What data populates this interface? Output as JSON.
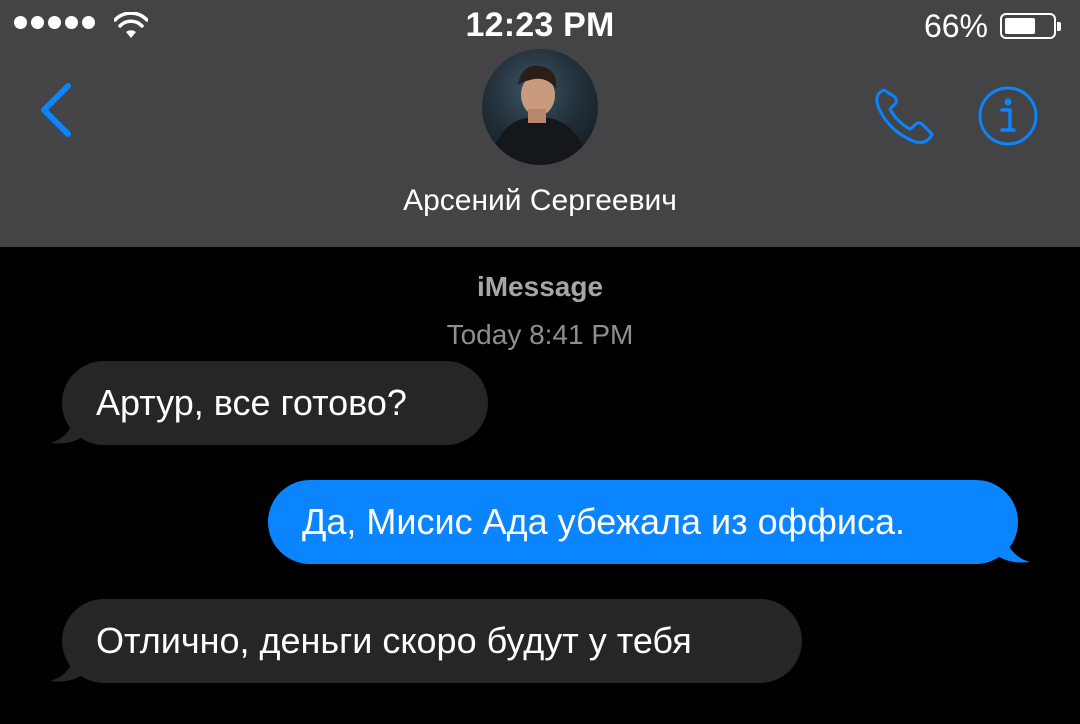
{
  "status_bar": {
    "time": "12:23 PM",
    "battery_percent": "66%",
    "battery_level": 0.66,
    "signal_bars": 5
  },
  "header": {
    "contact_name": "Арсений Сергеевич",
    "icons": {
      "back": "chevron-left-icon",
      "call": "phone-icon",
      "info": "info-icon"
    },
    "accent_color": "#0a84ff"
  },
  "thread": {
    "service": "iMessage",
    "timestamp": "Today 8:41 PM",
    "messages": [
      {
        "direction": "incoming",
        "text": "Артур, все готово?"
      },
      {
        "direction": "outgoing",
        "text": "Да, Мисис Ада убежала из оффиса."
      },
      {
        "direction": "incoming",
        "text": "Отлично, деньги скоро будут у тебя"
      }
    ]
  },
  "colors": {
    "header_bg": "#444446",
    "incoming_bubble": "#262628",
    "outgoing_bubble": "#0a84ff",
    "background": "#000000"
  }
}
